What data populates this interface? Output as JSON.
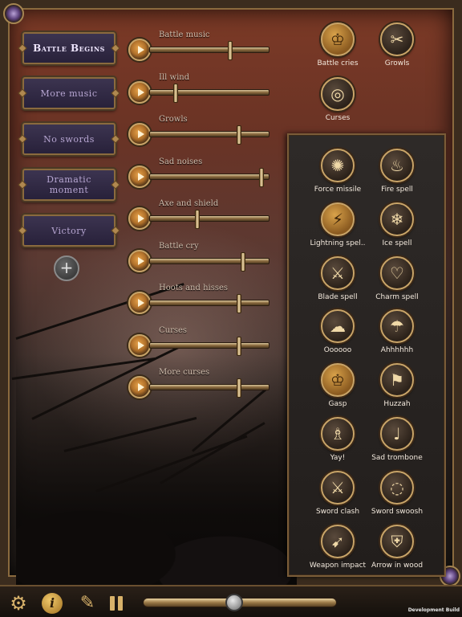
{
  "music_buttons": [
    {
      "label": "Battle Begins",
      "active": true
    },
    {
      "label": "More music",
      "active": false
    },
    {
      "label": "No swords",
      "active": false
    },
    {
      "label": "Dramatic moment",
      "active": false
    },
    {
      "label": "Victory",
      "active": false
    }
  ],
  "add_button": {
    "icon": "plus-icon"
  },
  "tracks": [
    {
      "label": "Battle music",
      "volume": 0.68
    },
    {
      "label": "Ill wind",
      "volume": 0.17
    },
    {
      "label": "Growls",
      "volume": 0.76
    },
    {
      "label": "Sad noises",
      "volume": 0.97
    },
    {
      "label": "Axe and shield",
      "volume": 0.37
    },
    {
      "label": "Battle cry",
      "volume": 0.8
    },
    {
      "label": "Hoots and hisses",
      "volume": 0.76
    },
    {
      "label": "Curses",
      "volume": 0.76
    },
    {
      "label": "More curses",
      "volume": 0.76
    }
  ],
  "top_effects": [
    {
      "label": "Battle cries",
      "icon": "crown-icon",
      "glyph": "♔",
      "gold": true
    },
    {
      "label": "Growls",
      "icon": "claw-icon",
      "glyph": "✂",
      "gold": false
    },
    {
      "label": "Curses",
      "icon": "ring-icon",
      "glyph": "◎",
      "gold": false
    }
  ],
  "effects": [
    {
      "label": "Force missile",
      "icon": "comet-icon",
      "glyph": "✺",
      "gold": false
    },
    {
      "label": "Fire spell",
      "icon": "flame-icon",
      "glyph": "♨",
      "gold": false
    },
    {
      "label": "Lightning spel..",
      "icon": "lightning-icon",
      "glyph": "⚡",
      "gold": true
    },
    {
      "label": "Ice spell",
      "icon": "snowflake-icon",
      "glyph": "❄",
      "gold": false
    },
    {
      "label": "Blade spell",
      "icon": "blade-icon",
      "glyph": "⚔",
      "gold": false
    },
    {
      "label": "Charm spell",
      "icon": "heart-knot-icon",
      "glyph": "♡",
      "gold": false
    },
    {
      "label": "Oooooo",
      "icon": "ghost-icon",
      "glyph": "☁",
      "gold": false
    },
    {
      "label": "Ahhhhhh",
      "icon": "crowd-icon",
      "glyph": "☂",
      "gold": false
    },
    {
      "label": "Gasp",
      "icon": "crown-icon",
      "glyph": "♔",
      "gold": true
    },
    {
      "label": "Huzzah",
      "icon": "banner-icon",
      "glyph": "⚑",
      "gold": false
    },
    {
      "label": "Yay!",
      "icon": "figures-icon",
      "glyph": "♗",
      "gold": false
    },
    {
      "label": "Sad trombone",
      "icon": "horn-icon",
      "glyph": "♩",
      "gold": false
    },
    {
      "label": "Sword clash",
      "icon": "swords-icon",
      "glyph": "⚔",
      "gold": false
    },
    {
      "label": "Sword swoosh",
      "icon": "swirl-icon",
      "glyph": "◌",
      "gold": false
    },
    {
      "label": "Weapon impact",
      "icon": "arrow-impact-icon",
      "glyph": "➹",
      "gold": false
    },
    {
      "label": "Arrow in wood",
      "icon": "shield-icon",
      "glyph": "⛨",
      "gold": false
    }
  ],
  "toolbar": {
    "master_volume": 0.47,
    "build_label": "Development Build"
  }
}
